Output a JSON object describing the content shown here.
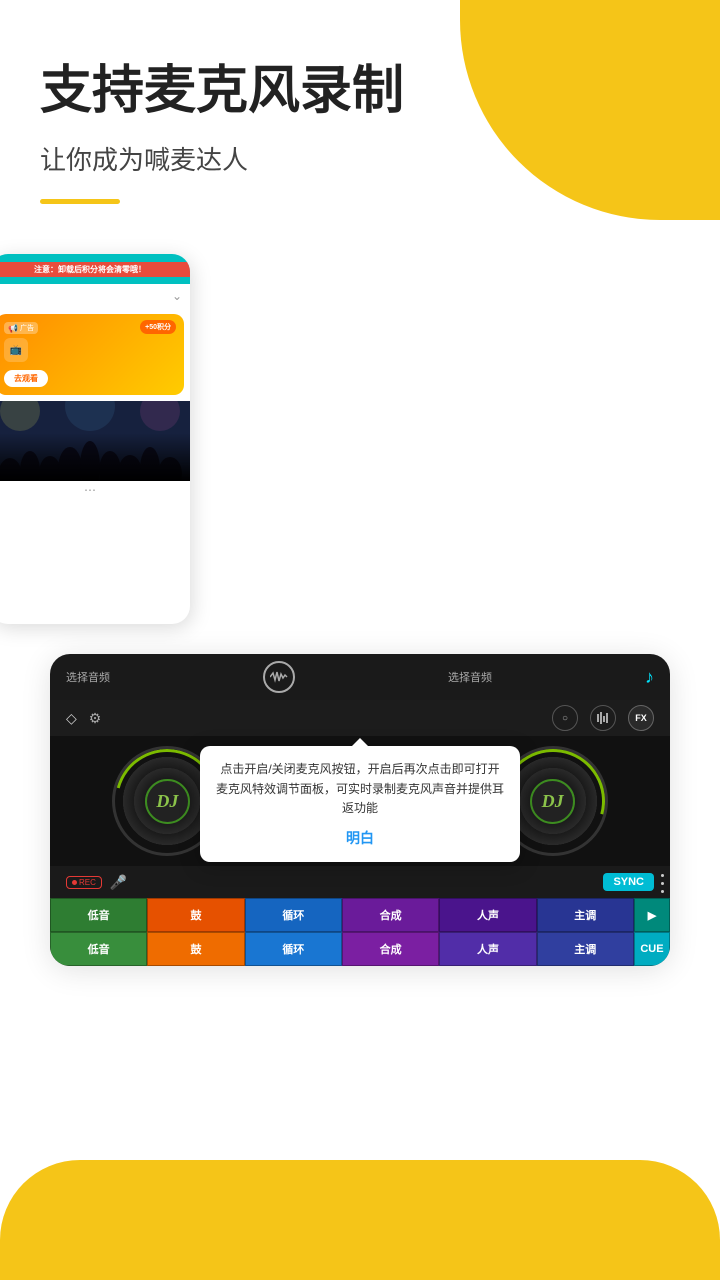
{
  "decorations": {
    "blob_top_right": "yellow-blob",
    "blob_bottom": "yellow-blob-bottom"
  },
  "header": {
    "title": "支持麦克风录制",
    "subtitle": "让你成为喊麦达人"
  },
  "first_mockup": {
    "warning_text": "注意：卸载后积分将会清零哦！",
    "ad_label": "广告",
    "points": "+50积分",
    "watch_btn": "去观看"
  },
  "second_mockup": {
    "header": {
      "left_label": "选择音频",
      "right_label": "选择音频"
    },
    "dialog": {
      "text": "点击开启/关闭麦克风按钮，开启后再次点击即可打开麦克风特效调节面板，可实时录制麦克风声音并提供耳返功能",
      "ok_button": "明白"
    },
    "rec_label": "REC",
    "sync_btn": "SYNC",
    "play_btn": "▶",
    "cue_btn": "CUE",
    "effects_row1": [
      {
        "label": "低音",
        "color": "#2e7d32"
      },
      {
        "label": "鼓",
        "color": "#e65100"
      },
      {
        "label": "循环",
        "color": "#1565c0"
      },
      {
        "label": "合成",
        "color": "#6a1b9a"
      },
      {
        "label": "人声",
        "color": "#4a148c"
      },
      {
        "label": "主调",
        "color": "#283593"
      }
    ],
    "effects_row2": [
      {
        "label": "低音",
        "color": "#388e3c"
      },
      {
        "label": "鼓",
        "color": "#ef6c00"
      },
      {
        "label": "循环",
        "color": "#1976d2"
      },
      {
        "label": "合成",
        "color": "#7b1fa2"
      },
      {
        "label": "人声",
        "color": "#512da8"
      },
      {
        "label": "主调",
        "color": "#303f9f"
      }
    ],
    "vinyl_label": "DJ",
    "fx_label": "FX"
  }
}
